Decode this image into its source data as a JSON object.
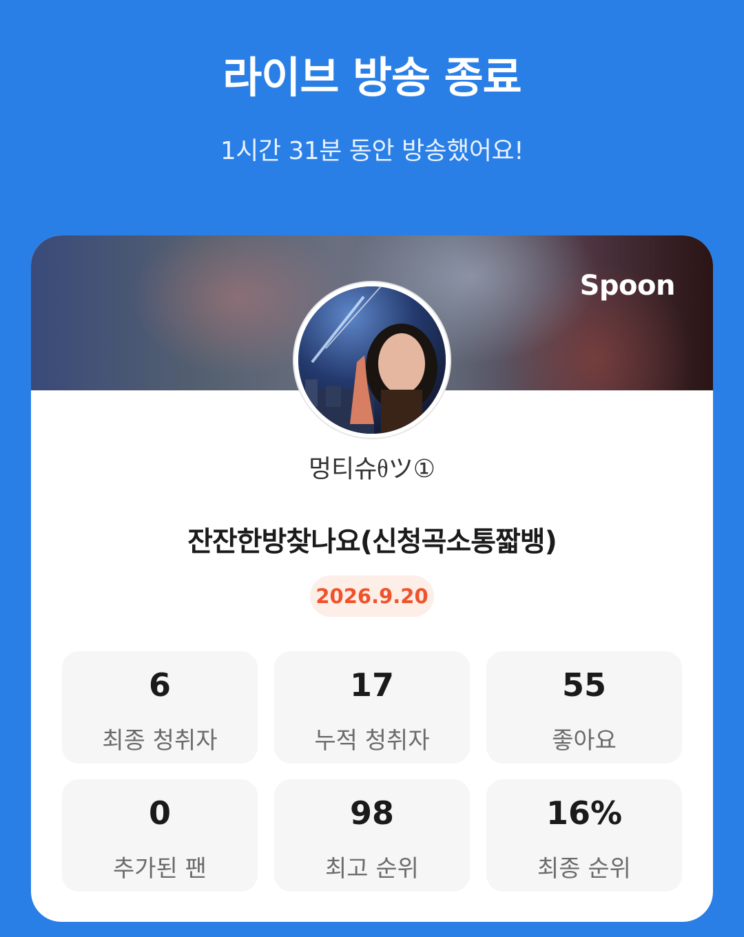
{
  "header": {
    "title": "라이브 방송 종료",
    "subtitle": "1시간 31분 동안 방송했어요!"
  },
  "card": {
    "brand": "Spoon",
    "username": "멍티슈ᦲツ①",
    "room_title": "잔잔한방찾나요(신청곡소통짧뱅)",
    "date": "2026.9.20",
    "stats": [
      {
        "value": "6",
        "label": "최종 청취자"
      },
      {
        "value": "17",
        "label": "누적 청취자"
      },
      {
        "value": "55",
        "label": "좋아요"
      },
      {
        "value": "0",
        "label": "추가된 팬"
      },
      {
        "value": "98",
        "label": "최고 순위"
      },
      {
        "value": "16%",
        "label": "최종 순위"
      }
    ]
  },
  "colors": {
    "background": "#2a7fe6",
    "card": "#ffffff",
    "date_badge_bg": "#fdeee7",
    "date_badge_text": "#f0522a",
    "stat_bg": "#f6f6f6"
  }
}
